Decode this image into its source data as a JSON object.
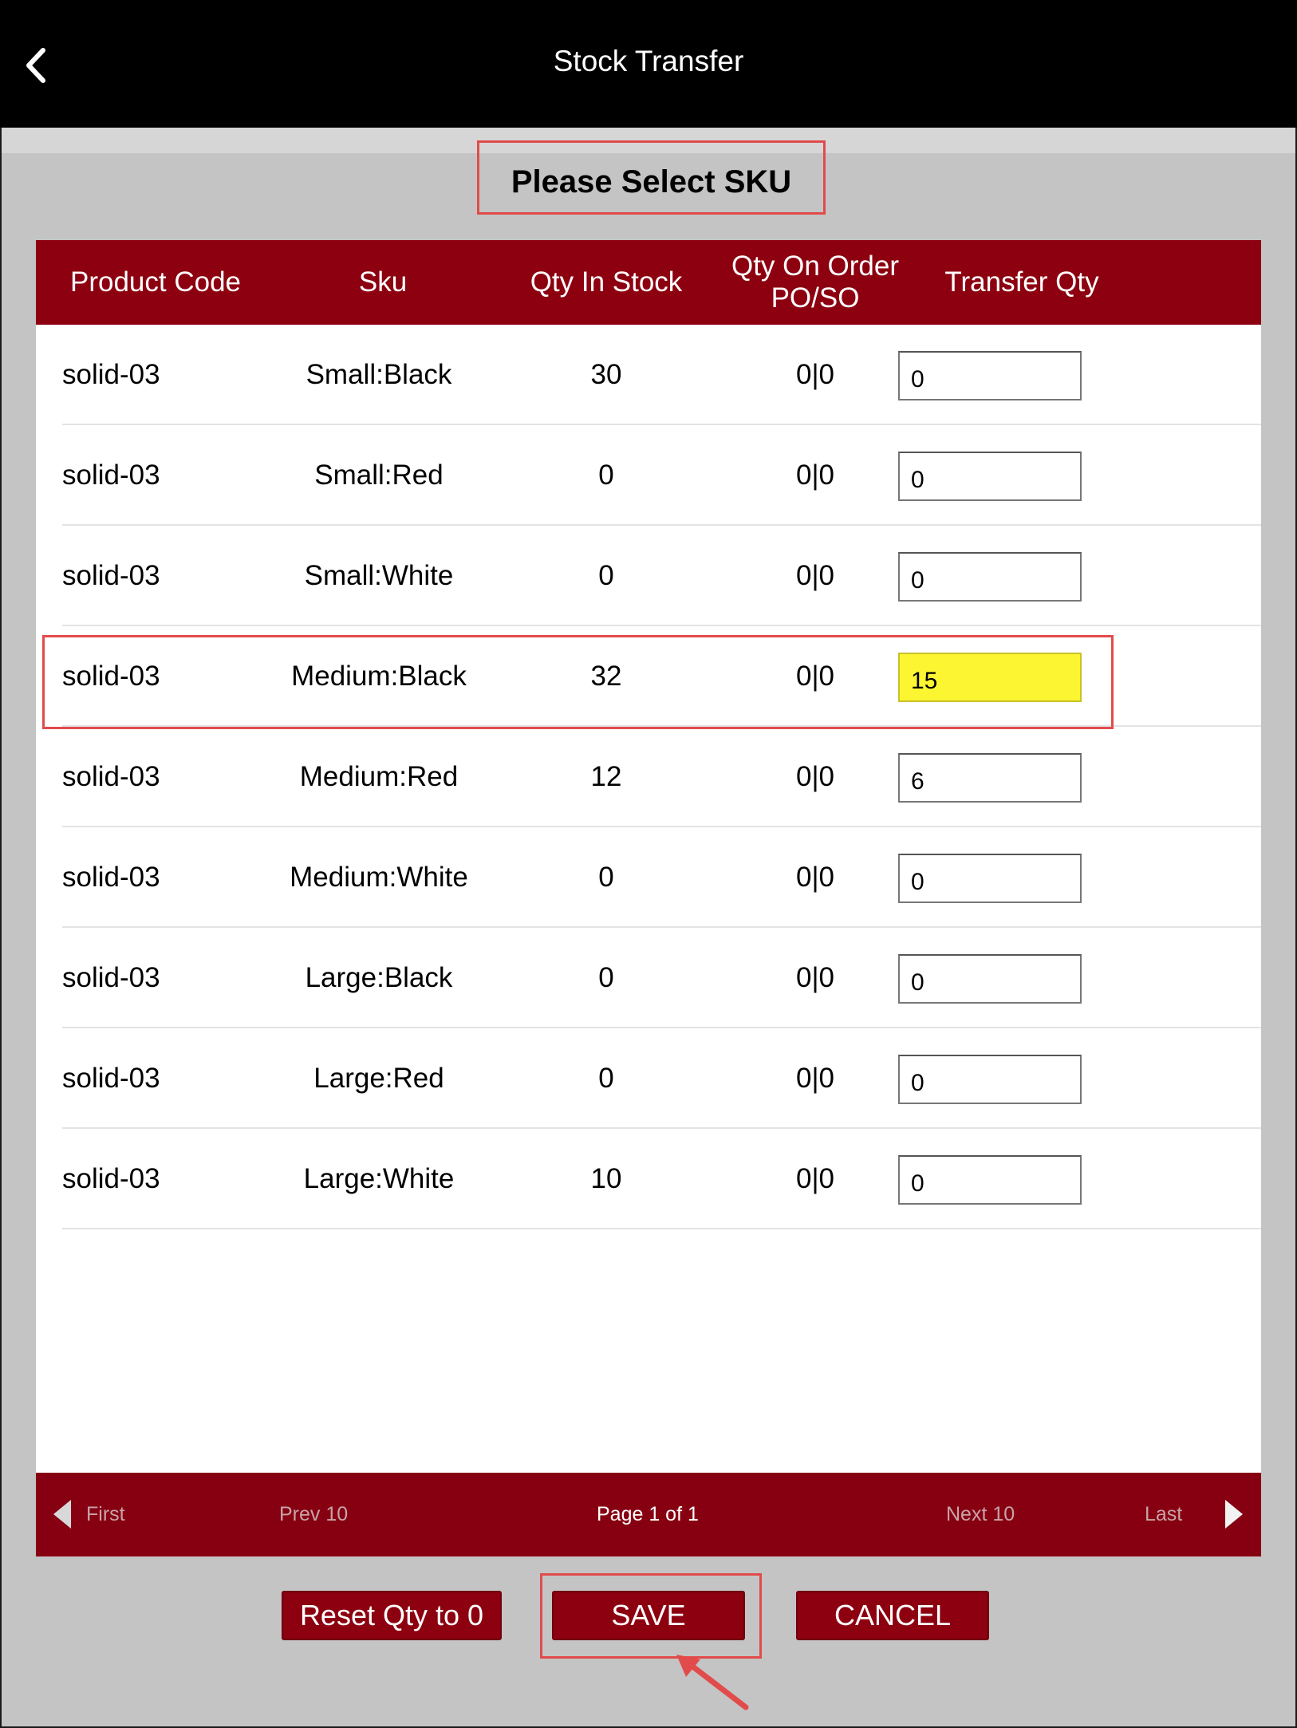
{
  "header": {
    "title": "Stock Transfer"
  },
  "prompt": "Please Select SKU",
  "table": {
    "columns": [
      "Product Code",
      "Sku",
      "Qty In Stock",
      "Qty On Order\nPO/SO",
      "Transfer Qty"
    ],
    "rows": [
      {
        "product_code": "solid-03",
        "sku": "Small:Black",
        "qty_in_stock": "30",
        "qty_on_order": "0|0",
        "transfer_qty": "0"
      },
      {
        "product_code": "solid-03",
        "sku": "Small:Red",
        "qty_in_stock": "0",
        "qty_on_order": "0|0",
        "transfer_qty": "0"
      },
      {
        "product_code": "solid-03",
        "sku": "Small:White",
        "qty_in_stock": "0",
        "qty_on_order": "0|0",
        "transfer_qty": "0"
      },
      {
        "product_code": "solid-03",
        "sku": "Medium:Black",
        "qty_in_stock": "32",
        "qty_on_order": "0|0",
        "transfer_qty": "15"
      },
      {
        "product_code": "solid-03",
        "sku": "Medium:Red",
        "qty_in_stock": "12",
        "qty_on_order": "0|0",
        "transfer_qty": "6"
      },
      {
        "product_code": "solid-03",
        "sku": "Medium:White",
        "qty_in_stock": "0",
        "qty_on_order": "0|0",
        "transfer_qty": "0"
      },
      {
        "product_code": "solid-03",
        "sku": "Large:Black",
        "qty_in_stock": "0",
        "qty_on_order": "0|0",
        "transfer_qty": "0"
      },
      {
        "product_code": "solid-03",
        "sku": "Large:Red",
        "qty_in_stock": "0",
        "qty_on_order": "0|0",
        "transfer_qty": "0"
      },
      {
        "product_code": "solid-03",
        "sku": "Large:White",
        "qty_in_stock": "10",
        "qty_on_order": "0|0",
        "transfer_qty": "0"
      }
    ]
  },
  "pager": {
    "first": "First",
    "prev": "Prev 10",
    "page_info": "Page 1 of 1",
    "next": "Next 10",
    "last": "Last"
  },
  "actions": {
    "reset": "Reset Qty to 0",
    "save": "SAVE",
    "cancel": "CANCEL"
  },
  "colors": {
    "header_bg": "#000000",
    "accent": "#8c0010",
    "highlight_input": "#fbf532",
    "annotation": "#e24b4b"
  }
}
